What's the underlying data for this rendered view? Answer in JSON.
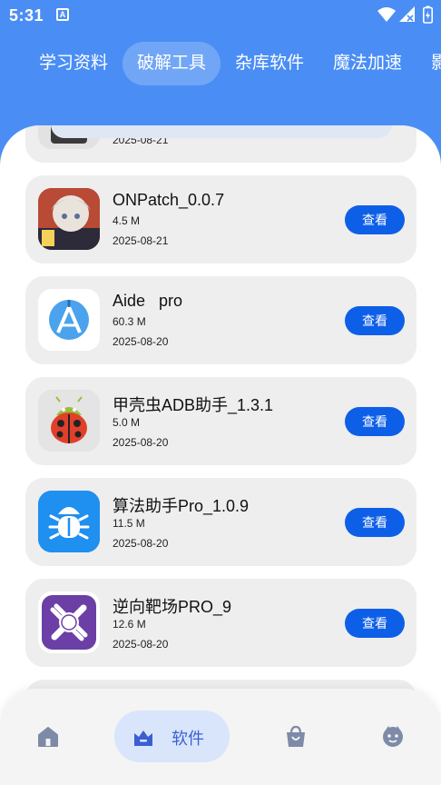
{
  "status": {
    "time": "5:31",
    "notif_letter": "A"
  },
  "tabs": [
    {
      "label": "学习资料",
      "active": false
    },
    {
      "label": "破解工具",
      "active": true
    },
    {
      "label": "杂库软件",
      "active": false
    },
    {
      "label": "魔法加速",
      "active": false
    },
    {
      "label": "影",
      "active": false
    }
  ],
  "apps": [
    {
      "name": "",
      "size": "",
      "date": "2025-08-21",
      "icon": "dark-app-icon"
    },
    {
      "name": "ONPatch_0.0.7",
      "size": "4.5 M",
      "date": "2025-08-21",
      "icon": "anime-avatar-icon"
    },
    {
      "name": "Aide   pro",
      "size": "60.3 M",
      "date": "2025-08-20",
      "icon": "android-studio-icon"
    },
    {
      "name": "甲壳虫ADB助手_1.3.1",
      "size": "5.0 M",
      "date": "2025-08-20",
      "icon": "ladybug-android-icon"
    },
    {
      "name": "算法助手Pro_1.0.9",
      "size": "11.5 M",
      "date": "2025-08-20",
      "icon": "bug-icon"
    },
    {
      "name": "逆向靶场PRO_9",
      "size": "12.6 M",
      "date": "2025-08-20",
      "icon": "tool-badge-icon"
    }
  ],
  "view_label": "查看",
  "bottom_nav": {
    "active_label": "软件"
  },
  "colors": {
    "accent": "#4a8ef5",
    "button": "#0e5fe8",
    "nav_active_bg": "#d9e5fb"
  }
}
